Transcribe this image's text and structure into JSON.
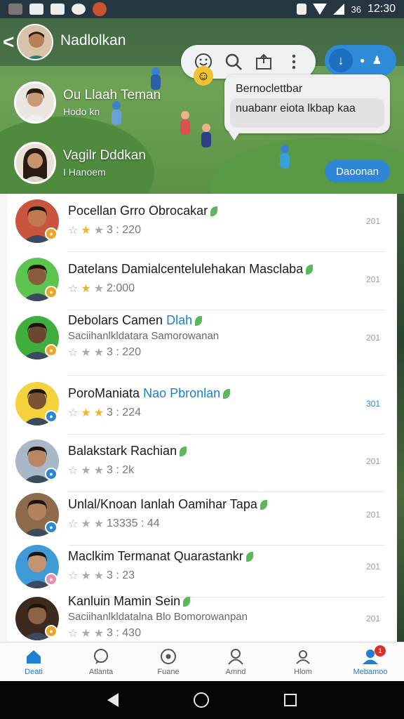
{
  "status_bar": {
    "time": "12:30",
    "battery": "36"
  },
  "header": {
    "back_label": "<",
    "title": "Nadlolkan",
    "bubble_title": "Bernoclettbar",
    "bubble_text": "nuabanr eiota lkbap kaa",
    "pinned": [
      {
        "name": "Ou Llaah Teman",
        "sub": "Hodo kn"
      },
      {
        "name": "Vagilr Dddkan",
        "sub": "I Hanoem"
      }
    ],
    "follow_label": "Daoonan"
  },
  "chats": [
    {
      "title": "Pocellan Grro Obrocakar",
      "highlight": "",
      "sub": "",
      "rating": "3 : 220",
      "stars": 1,
      "time": "201",
      "time_blue": false,
      "badge_color": "#f0a425",
      "av_bg": "#c8553d",
      "skin": "#c07a50"
    },
    {
      "title": "Datelans Damialcentelulehakan Masclaba",
      "highlight": "",
      "sub": "",
      "rating": "2:000",
      "stars": 1,
      "time": "201",
      "time_blue": false,
      "badge_color": "#f0a425",
      "av_bg": "#5cc44f",
      "skin": "#8a5a3a"
    },
    {
      "title": "Debolars Camen",
      "highlight": "Dlah",
      "sub": "Saciihanlkldatara Samorowanan",
      "rating": "3 : 220",
      "stars": 0,
      "time": "201",
      "time_blue": false,
      "badge_color": "#f0a425",
      "av_bg": "#3fae3c",
      "skin": "#6b4630"
    },
    {
      "title": "PoroManiata",
      "highlight": "Nao Pbronlan",
      "sub": "",
      "rating": "3 : 224",
      "stars": 2,
      "time": "301",
      "time_blue": true,
      "badge_color": "#2a86d6",
      "av_bg": "#f3d23b",
      "skin": "#7a5234"
    },
    {
      "title": "Balakstark Rachian",
      "highlight": "",
      "sub": "",
      "rating": "3 : 2k",
      "stars": 0,
      "time": "201",
      "time_blue": false,
      "badge_color": "#2a86d6",
      "av_bg": "#a9b8c6",
      "skin": "#b98664"
    },
    {
      "title": "Unlal/Knoan Ianlah Oamihar Tapa",
      "highlight": "",
      "sub": "",
      "rating": "13335 : 44",
      "stars": 0,
      "time": "201",
      "time_blue": false,
      "badge_color": "#2a86d6",
      "av_bg": "#8c6a4a",
      "skin": "#b3835c"
    },
    {
      "title": "Maclkim Termanat Quarastankr",
      "highlight": "",
      "sub": "",
      "rating": "3 : 23",
      "stars": 0,
      "time": "201",
      "time_blue": false,
      "badge_color": "#e68fb0",
      "av_bg": "#3f9bd6",
      "skin": "#c49472"
    },
    {
      "title": "Kanluin Mamin Sein",
      "highlight": "",
      "sub": "Saciihanlkldatalna Blo Bomorowanpan",
      "rating": "3 : 430",
      "stars": 0,
      "time": "201",
      "time_blue": false,
      "badge_color": "#f0a425",
      "av_bg": "#3d2a1e",
      "skin": "#8b6446"
    }
  ],
  "bottom_nav": [
    {
      "label": "Deati",
      "icon": "home-icon",
      "active": true
    },
    {
      "label": "Atlanta",
      "icon": "chat-icon",
      "active": false
    },
    {
      "label": "Fuane",
      "icon": "ball-icon",
      "active": false
    },
    {
      "label": "Amnd",
      "icon": "user-icon",
      "active": false
    },
    {
      "label": "Hlom",
      "icon": "person-star-icon",
      "active": false
    },
    {
      "label": "Mebamoo",
      "icon": "profile-icon",
      "active": true,
      "badge": "1"
    }
  ],
  "colors": {
    "accent": "#2d86d6",
    "header_green": "#6ea355",
    "star": "#f0b429"
  }
}
